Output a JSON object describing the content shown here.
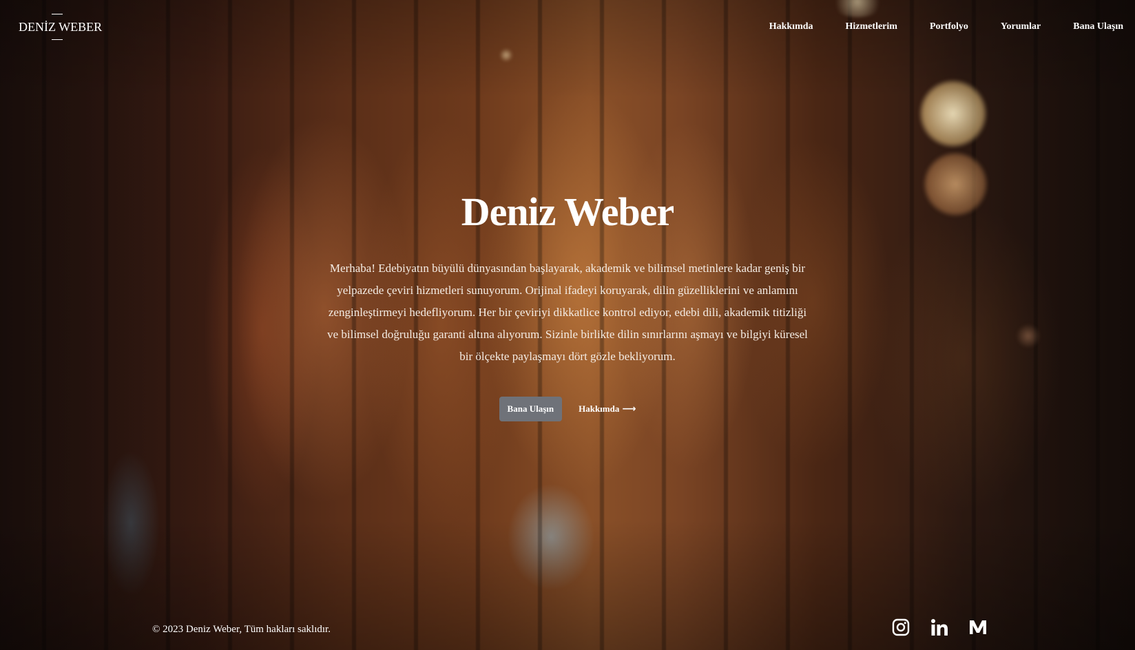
{
  "header": {
    "logo_text": "DENİZ WEBER",
    "nav": [
      {
        "label": "Hakkımda"
      },
      {
        "label": "Hizmetlerim"
      },
      {
        "label": "Portfolyo"
      },
      {
        "label": "Yorumlar"
      },
      {
        "label": "Bana Ulaşın"
      }
    ]
  },
  "hero": {
    "title": "Deniz Weber",
    "text": "Merhaba! Edebiyatın büyülü dünyasından başlayarak, akademik ve bilimsel metinlere kadar geniş bir yelpazede çeviri hizmetleri sunuyorum. Orijinal ifadeyi koruyarak, dilin güzelliklerini ve anlamını zenginleştirmeyi hedefliyorum. Her bir çeviriyi dikkatlice kontrol ediyor, edebi dili, akademik titizliği ve bilimsel doğruluğu garanti altına alıyorum. Sizinle birlikte dilin sınırlarını aşmayı ve bilgiyi küresel bir ölçekte paylaşmayı dört gözle bekliyorum.",
    "primary_button": "Bana Ulaşın",
    "secondary_button": "Hakkımda",
    "secondary_icon": "arrow-right-icon"
  },
  "footer": {
    "copyright": "© 2023 Deniz Weber, Tüm hakları saklıdır.",
    "social": [
      {
        "icon": "instagram-icon"
      },
      {
        "icon": "linkedin-icon"
      },
      {
        "icon": "medium-icon"
      }
    ]
  },
  "colors": {
    "text": "#ffffff",
    "button_bg": "#6f7279",
    "background_dark": "#1a0e0a",
    "background_warm": "#8a5028"
  }
}
